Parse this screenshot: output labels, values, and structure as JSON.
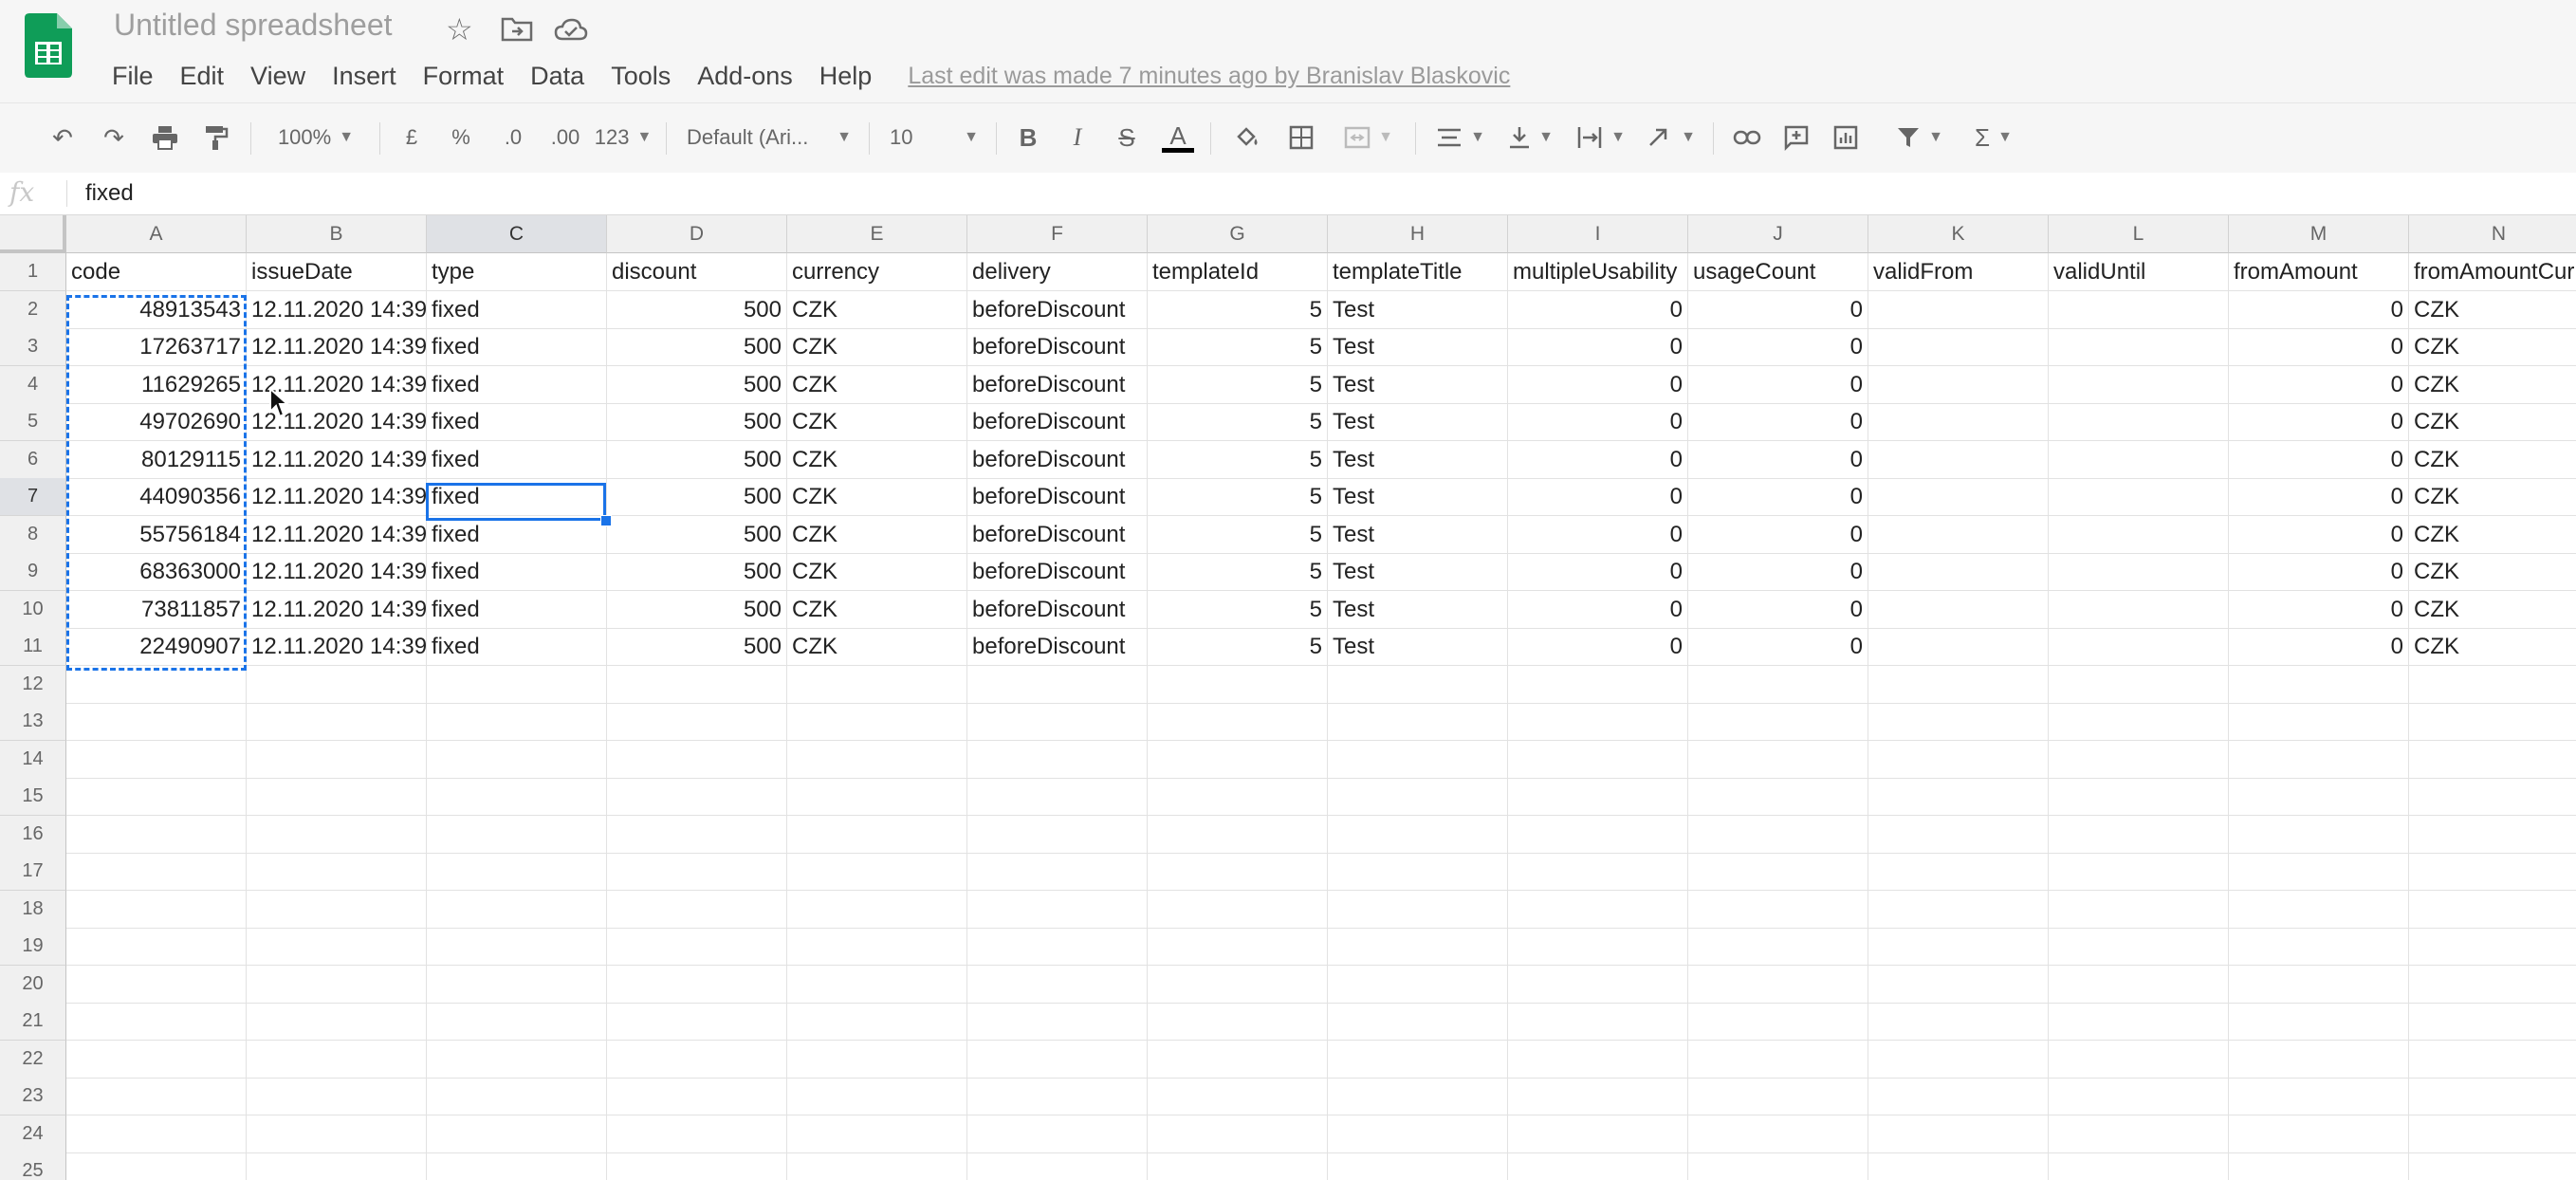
{
  "app": {
    "name": "Google Sheets"
  },
  "doc": {
    "title": "Untitled spreadsheet"
  },
  "icons": {
    "star": "star-icon",
    "move": "move-to-folder-icon",
    "cloud": "cloud-status-icon"
  },
  "menu": [
    "File",
    "Edit",
    "View",
    "Insert",
    "Format",
    "Data",
    "Tools",
    "Add-ons",
    "Help"
  ],
  "last_edit": "Last edit was made 7 minutes ago by Branislav Blaskovic",
  "toolbar": {
    "zoom": "100%",
    "currency": "£",
    "percent": "%",
    "dec_decrease": ".0",
    "dec_increase": ".00",
    "more_formats": "123",
    "font": "Default (Ari...",
    "font_size": "10",
    "bold": "B",
    "italic": "I",
    "strike": "S",
    "text_color": "A",
    "sigma": "Σ"
  },
  "formula": {
    "fx": "fx",
    "value": "fixed"
  },
  "colors": {
    "accent": "#1a73e8",
    "sheets_green": "#0f9d58"
  },
  "sheet": {
    "columns": [
      "A",
      "B",
      "C",
      "D",
      "E",
      "F",
      "G",
      "H",
      "I",
      "J",
      "K",
      "L",
      "M",
      "N"
    ],
    "selected_column": "C",
    "selected_row": 7,
    "row_count": 25,
    "rows": [
      [
        "code",
        "issueDate",
        "type",
        "discount",
        "currency",
        "delivery",
        "templateId",
        "templateTitle",
        "multipleUsability",
        "usageCount",
        "validFrom",
        "validUntil",
        "fromAmount",
        "fromAmountCurrency"
      ],
      [
        "48913543",
        "12.11.2020 14:39",
        "fixed",
        "500",
        "CZK",
        "beforeDiscount",
        "5",
        "Test",
        "0",
        "0",
        "",
        "",
        "0",
        "CZK"
      ],
      [
        "17263717",
        "12.11.2020 14:39",
        "fixed",
        "500",
        "CZK",
        "beforeDiscount",
        "5",
        "Test",
        "0",
        "0",
        "",
        "",
        "0",
        "CZK"
      ],
      [
        "11629265",
        "12.11.2020 14:39",
        "fixed",
        "500",
        "CZK",
        "beforeDiscount",
        "5",
        "Test",
        "0",
        "0",
        "",
        "",
        "0",
        "CZK"
      ],
      [
        "49702690",
        "12.11.2020 14:39",
        "fixed",
        "500",
        "CZK",
        "beforeDiscount",
        "5",
        "Test",
        "0",
        "0",
        "",
        "",
        "0",
        "CZK"
      ],
      [
        "80129115",
        "12.11.2020 14:39",
        "fixed",
        "500",
        "CZK",
        "beforeDiscount",
        "5",
        "Test",
        "0",
        "0",
        "",
        "",
        "0",
        "CZK"
      ],
      [
        "44090356",
        "12.11.2020 14:39",
        "fixed",
        "500",
        "CZK",
        "beforeDiscount",
        "5",
        "Test",
        "0",
        "0",
        "",
        "",
        "0",
        "CZK"
      ],
      [
        "55756184",
        "12.11.2020 14:39",
        "fixed",
        "500",
        "CZK",
        "beforeDiscount",
        "5",
        "Test",
        "0",
        "0",
        "",
        "",
        "0",
        "CZK"
      ],
      [
        "68363000",
        "12.11.2020 14:39",
        "fixed",
        "500",
        "CZK",
        "beforeDiscount",
        "5",
        "Test",
        "0",
        "0",
        "",
        "",
        "0",
        "CZK"
      ],
      [
        "73811857",
        "12.11.2020 14:39",
        "fixed",
        "500",
        "CZK",
        "beforeDiscount",
        "5",
        "Test",
        "0",
        "0",
        "",
        "",
        "0",
        "CZK"
      ],
      [
        "22490907",
        "12.11.2020 14:39",
        "fixed",
        "500",
        "CZK",
        "beforeDiscount",
        "5",
        "Test",
        "0",
        "0",
        "",
        "",
        "0",
        "CZK"
      ]
    ]
  }
}
